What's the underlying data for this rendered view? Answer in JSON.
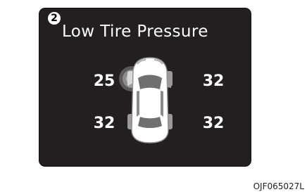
{
  "display": {
    "marker": "2",
    "title": "Low Tire Pressure",
    "tires": {
      "front_left": "25",
      "front_right": "32",
      "rear_left": "32",
      "rear_right": "32"
    },
    "low_tire": "front_left",
    "low_tire_indicator_color": "#8c8c8c",
    "panel_color": "#231f20"
  },
  "figure_id": "OJF065027L",
  "icons": {
    "marker": "circled-number-icon",
    "car": "car-top-view-icon",
    "warning": "low-pressure-highlight-icon"
  }
}
